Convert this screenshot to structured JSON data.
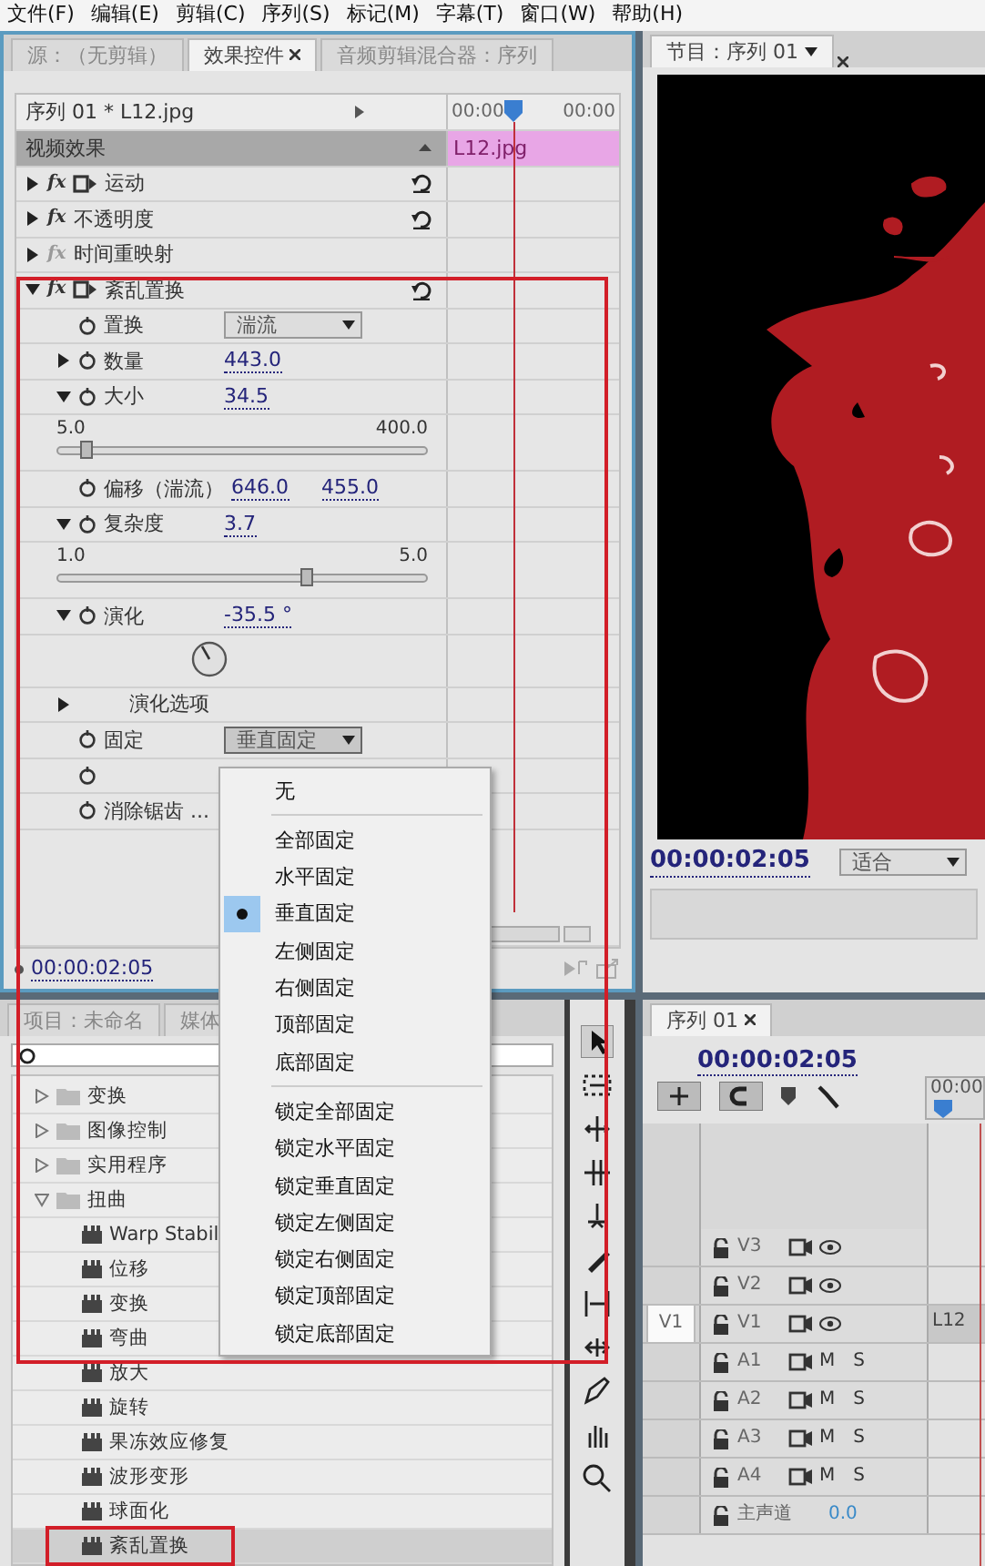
{
  "menu_bar": [
    "文件(F)",
    "编辑(E)",
    "剪辑(C)",
    "序列(S)",
    "标记(M)",
    "字幕(T)",
    "窗口(W)",
    "帮助(H)"
  ],
  "effect_controls": {
    "tabs": [
      {
        "label": "源：（无剪辑）",
        "selected": false
      },
      {
        "label": "效果控件",
        "selected": true
      },
      {
        "label": "音频剪辑混合器：序列",
        "selected": false
      }
    ],
    "clip_header": "序列 01 * L12.jpg",
    "ruler_labels": [
      "00:00",
      "00:00"
    ],
    "section": "视频效果",
    "clip_bar": "L12.jpg",
    "effects": [
      {
        "badge": "fx",
        "label": "运动",
        "expanded": false,
        "fx_dimmed": false,
        "transform_icon": true,
        "reset": true
      },
      {
        "badge": "fx",
        "label": "不透明度",
        "expanded": false,
        "fx_dimmed": false,
        "transform_icon": false,
        "reset": true
      },
      {
        "badge": "fx",
        "label": "时间重映射",
        "expanded": false,
        "fx_dimmed": true,
        "transform_icon": false,
        "reset": false
      },
      {
        "badge": "fx",
        "label": "紊乱置换",
        "expanded": true,
        "fx_dimmed": false,
        "transform_icon": true,
        "reset": true,
        "params": [
          {
            "kind": "dropdown",
            "label": "置换",
            "value": "湍流",
            "open": false
          },
          {
            "kind": "number",
            "label": "数量",
            "value": "443.0",
            "expanded": false
          },
          {
            "kind": "number",
            "label": "大小",
            "value": "34.5",
            "expanded": true,
            "slider": {
              "min": "5.0",
              "max": "400.0",
              "level": 0.075
            }
          },
          {
            "kind": "pair",
            "label": "偏移（湍流）",
            "values": [
              "646.0",
              "455.0"
            ]
          },
          {
            "kind": "number",
            "label": "复杂度",
            "value": "3.7",
            "expanded": true,
            "slider": {
              "min": "1.0",
              "max": "5.0",
              "level": 0.675
            }
          },
          {
            "kind": "angle",
            "label": "演化",
            "value": "-35.5 °",
            "expanded": true
          },
          {
            "kind": "group",
            "label": "演化选项",
            "expanded": false
          },
          {
            "kind": "dropdown",
            "label": "固定",
            "value": "垂直固定",
            "open": true
          },
          {
            "kind": "covered"
          },
          {
            "kind": "label",
            "label": "消除锯齿 ..."
          }
        ]
      }
    ],
    "timecode": "00:00:02:05"
  },
  "fixed_menu": {
    "items": [
      {
        "kind": "item",
        "label": "无",
        "selected": false
      },
      {
        "kind": "separator"
      },
      {
        "kind": "item",
        "label": "全部固定",
        "selected": false
      },
      {
        "kind": "item",
        "label": "水平固定",
        "selected": false
      },
      {
        "kind": "item",
        "label": "垂直固定",
        "selected": true
      },
      {
        "kind": "item",
        "label": "左侧固定",
        "selected": false
      },
      {
        "kind": "item",
        "label": "右侧固定",
        "selected": false
      },
      {
        "kind": "item",
        "label": "顶部固定",
        "selected": false
      },
      {
        "kind": "item",
        "label": "底部固定",
        "selected": false
      },
      {
        "kind": "separator"
      },
      {
        "kind": "item",
        "label": "锁定全部固定",
        "selected": false
      },
      {
        "kind": "item",
        "label": "锁定水平固定",
        "selected": false
      },
      {
        "kind": "item",
        "label": "锁定垂直固定",
        "selected": false
      },
      {
        "kind": "item",
        "label": "锁定左侧固定",
        "selected": false
      },
      {
        "kind": "item",
        "label": "锁定右侧固定",
        "selected": false
      },
      {
        "kind": "item",
        "label": "锁定顶部固定",
        "selected": false
      },
      {
        "kind": "item",
        "label": "锁定底部固定",
        "selected": false
      }
    ]
  },
  "project": {
    "tabs": [
      "项目：未命名",
      "媒体"
    ],
    "tree": [
      {
        "label": "变换",
        "expanded": false
      },
      {
        "label": "图像控制",
        "expanded": false
      },
      {
        "label": "实用程序",
        "expanded": false
      },
      {
        "label": "扭曲",
        "expanded": true,
        "children": [
          {
            "label": "Warp Stabil",
            "selected": false
          },
          {
            "label": "位移",
            "selected": false
          },
          {
            "label": "变换",
            "selected": false
          },
          {
            "label": "弯曲",
            "selected": false
          },
          {
            "label": "放大",
            "selected": false
          },
          {
            "label": "旋转",
            "selected": false
          },
          {
            "label": "果冻效应修复",
            "selected": false
          },
          {
            "label": "波形变形",
            "selected": false
          },
          {
            "label": "球面化",
            "selected": false
          },
          {
            "label": "紊乱置换",
            "selected": true
          }
        ]
      }
    ]
  },
  "program": {
    "tab": "节目：序列 01",
    "timecode": "00:00:02:05",
    "zoom": "适合"
  },
  "timeline": {
    "tab": "序列 01",
    "timecode": "00:00:02:05",
    "ruler": "00:00",
    "tracks": [
      {
        "kind": "video",
        "name": "V3"
      },
      {
        "kind": "video",
        "name": "V2"
      },
      {
        "kind": "video",
        "name": "V1",
        "source": "V1",
        "clip": "L12"
      },
      {
        "kind": "audio",
        "name": "A1",
        "mute": "M",
        "solo": "S"
      },
      {
        "kind": "audio",
        "name": "A2",
        "mute": "M",
        "solo": "S"
      },
      {
        "kind": "audio",
        "name": "A3",
        "mute": "M",
        "solo": "S"
      },
      {
        "kind": "audio",
        "name": "A4",
        "mute": "M",
        "solo": "S"
      },
      {
        "kind": "master",
        "name": "主声道",
        "volume": "0.0"
      }
    ]
  }
}
